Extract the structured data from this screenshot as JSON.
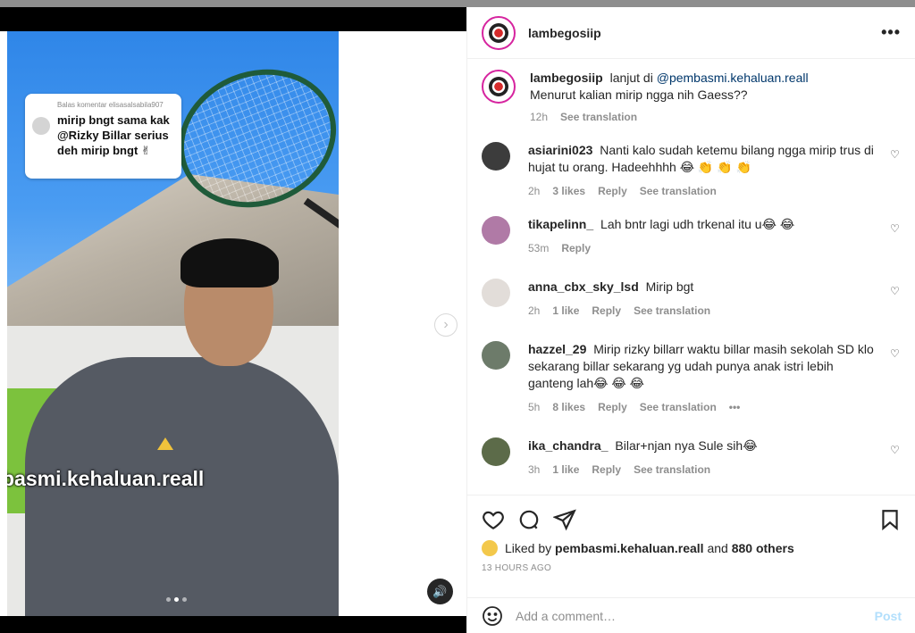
{
  "post": {
    "username": "lambegosiip",
    "more_label": "•••"
  },
  "media": {
    "comment_card": {
      "header": "Balas komentar elisasalsabila907",
      "text": "mirip bngt sama kak @Rizky Billar serius deh mirip bngt ✌"
    },
    "watermark": "basmi.kehaluan.reall",
    "next_label": "›",
    "sound_label": "🔊"
  },
  "caption": {
    "username": "lambegosiip",
    "text_before": "lanjut di",
    "mention": "@pembasmi.kehaluan.reall",
    "text_after": "Menurut kalian mirip ngga nih Gaess??",
    "time": "12h",
    "translate": "See translation"
  },
  "comments": [
    {
      "user": "asiarini023",
      "text": "Nanti kalo sudah ketemu bilang ngga mirip trus di hujat tu orang. Hadeehhhh 😂 👏 👏 👏",
      "time": "2h",
      "likes": "3 likes",
      "reply": "Reply",
      "translate": "See translation"
    },
    {
      "user": "tikapelinn_",
      "text": "Lah bntr lagi udh trkenal itu u😂 😂",
      "time": "53m",
      "reply": "Reply"
    },
    {
      "user": "anna_cbx_sky_lsd",
      "text": "Mirip bgt",
      "time": "2h",
      "likes": "1 like",
      "reply": "Reply",
      "translate": "See translation"
    },
    {
      "user": "hazzel_29",
      "text": "Mirip rizky billarr waktu billar masih sekolah SD klo sekarang billar sekarang yg udah punya anak istri lebih ganteng lah😂 😂 😂",
      "time": "5h",
      "likes": "8 likes",
      "reply": "Reply",
      "translate": "See translation",
      "more": "•••"
    },
    {
      "user": "ika_chandra_",
      "text": "Bilar+njan nya Sule sih😂",
      "time": "3h",
      "likes": "1 like",
      "reply": "Reply",
      "translate": "See translation"
    }
  ],
  "likes": {
    "prefix": "Liked by",
    "user": "pembasmi.kehaluan.reall",
    "and": "and",
    "others": "880 others"
  },
  "timestamp": "13 HOURS AGO",
  "add_comment": {
    "placeholder": "Add a comment…",
    "post_label": "Post"
  }
}
